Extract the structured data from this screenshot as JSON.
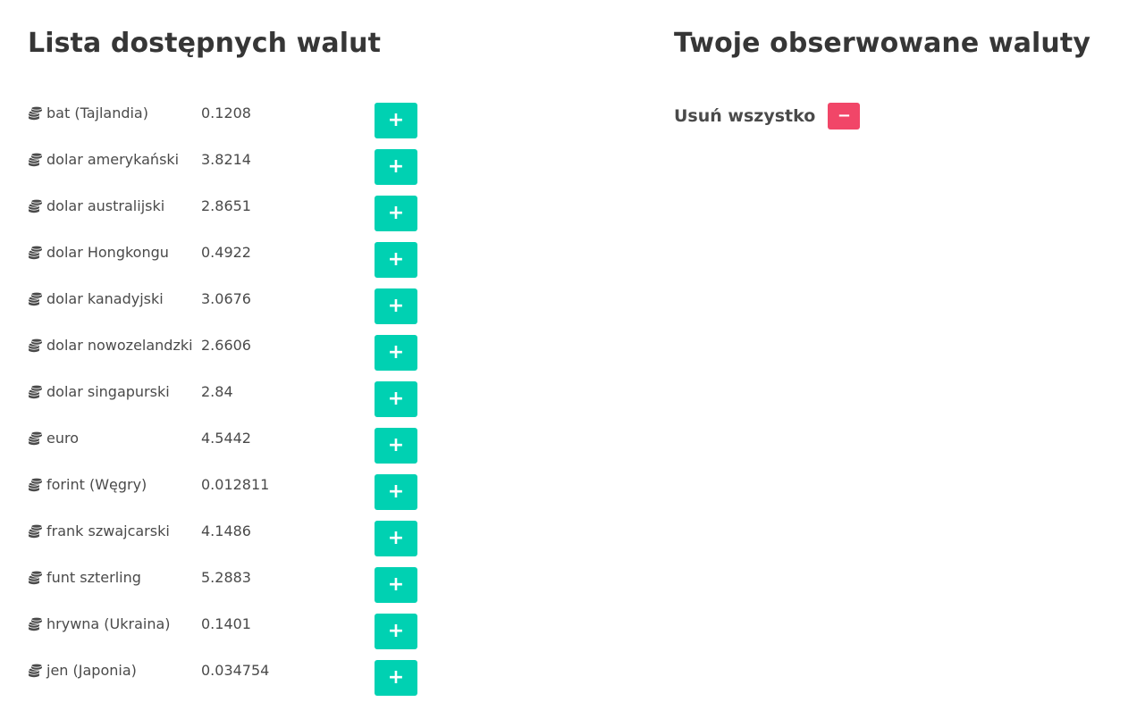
{
  "available": {
    "title": "Lista dostępnych walut",
    "add_label": "+",
    "icon": "coins-icon",
    "currencies": [
      {
        "name": "bat (Tajlandia)",
        "rate": "0.1208"
      },
      {
        "name": "dolar amerykański",
        "rate": "3.8214"
      },
      {
        "name": "dolar australijski",
        "rate": "2.8651"
      },
      {
        "name": "dolar Hongkongu",
        "rate": "0.4922"
      },
      {
        "name": "dolar kanadyjski",
        "rate": "3.0676"
      },
      {
        "name": "dolar nowozelandzki",
        "rate": "2.6606"
      },
      {
        "name": "dolar singapurski",
        "rate": "2.84"
      },
      {
        "name": "euro",
        "rate": "4.5442"
      },
      {
        "name": "forint (Węgry)",
        "rate": "0.012811"
      },
      {
        "name": "frank szwajcarski",
        "rate": "4.1486"
      },
      {
        "name": "funt szterling",
        "rate": "5.2883"
      },
      {
        "name": "hrywna (Ukraina)",
        "rate": "0.1401"
      },
      {
        "name": "jen (Japonia)",
        "rate": "0.034754"
      }
    ]
  },
  "watched": {
    "title": "Twoje obserwowane waluty",
    "remove_all_label": "Usuń wszystko",
    "remove_button_label": "−"
  },
  "colors": {
    "add_button": "#00d1b2",
    "remove_button": "#f14668",
    "heading": "#363636",
    "text": "#4a4a4a"
  }
}
